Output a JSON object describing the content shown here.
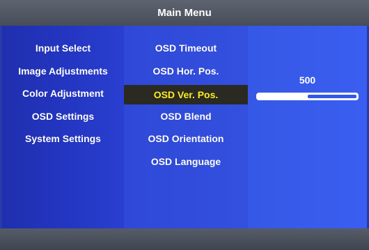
{
  "title": "Main Menu",
  "main_menu": {
    "items": [
      {
        "label": "Input Select"
      },
      {
        "label": "Image Adjustments"
      },
      {
        "label": "Color Adjustment"
      },
      {
        "label": "OSD Settings"
      },
      {
        "label": "System Settings"
      }
    ]
  },
  "osd_settings": {
    "items": [
      {
        "label": "OSD Timeout"
      },
      {
        "label": "OSD Hor. Pos."
      },
      {
        "label": "OSD Ver. Pos."
      },
      {
        "label": "OSD Blend"
      },
      {
        "label": "OSD Orientation"
      },
      {
        "label": "OSD Language"
      }
    ],
    "selected_index": 2
  },
  "value_panel": {
    "value": "500",
    "slider_fraction": 0.5
  },
  "colors": {
    "highlight_text": "#ffee22",
    "highlight_bg": "#2a2a22"
  }
}
